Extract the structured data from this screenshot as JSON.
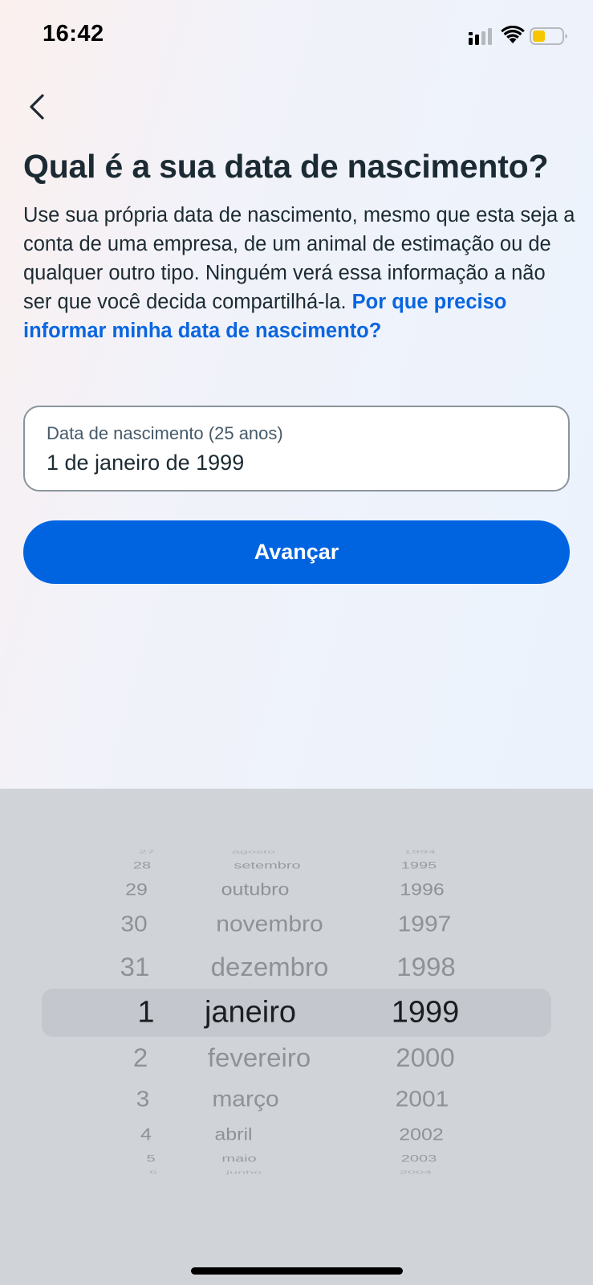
{
  "status_bar": {
    "time": "16:42"
  },
  "header": {
    "back_icon": "chevron-left-icon"
  },
  "main": {
    "title": "Qual é a sua data de nascimento?",
    "description": "Use sua própria data de nascimento, mesmo que esta seja a conta de uma empresa, de um animal de estimação ou de qualquer outro tipo. Ninguém verá essa informação a não ser que você decida compartilhá-la.",
    "description_link": "Por que preciso informar minha data de nascimento?",
    "birthdate_field": {
      "label": "Data de nascimento (25 anos)",
      "value": "1 de janeiro de 1999"
    },
    "next_button": "Avançar"
  },
  "picker": {
    "days": [
      "27",
      "28",
      "29",
      "30",
      "31",
      "1",
      "2",
      "3",
      "4",
      "5",
      "6"
    ],
    "months": [
      "agosto",
      "setembro",
      "outubro",
      "novembro",
      "dezembro",
      "janeiro",
      "fevereiro",
      "março",
      "abril",
      "maio",
      "junho"
    ],
    "years": [
      "1994",
      "1995",
      "1996",
      "1997",
      "1998",
      "1999",
      "2000",
      "2001",
      "2002",
      "2003",
      "2004"
    ],
    "selected": {
      "day": "1",
      "month": "janeiro",
      "year": "1999"
    }
  },
  "colors": {
    "accent": "#0064e0",
    "link": "#0a66e0",
    "picker_background": "#d0d4d9",
    "battery_fill": "#f7c600"
  }
}
